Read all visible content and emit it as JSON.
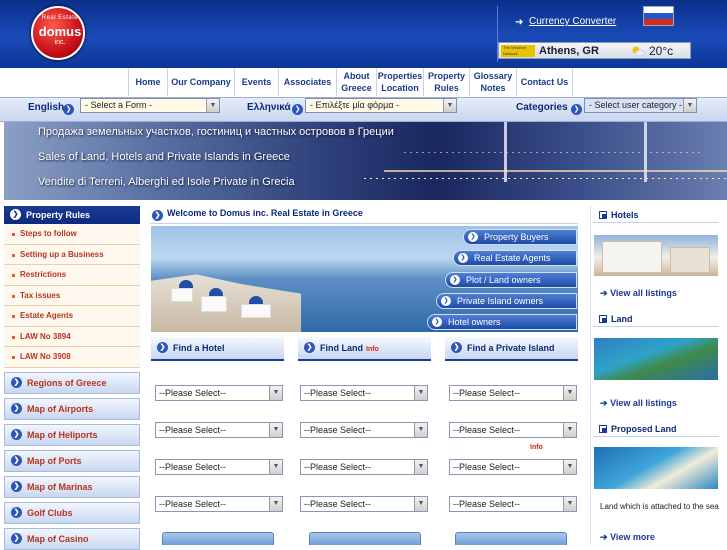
{
  "logo": {
    "top": "Real Estate",
    "name": "domus",
    "sub": "inc."
  },
  "header": {
    "currency_converter": "Currency Converter",
    "weather": {
      "provider": "The Weather Network",
      "city": "Athens, GR",
      "temp": "20°c"
    },
    "flag_colors": [
      "#ffffff",
      "#2456c8",
      "#d52b1e"
    ]
  },
  "topnav": [
    {
      "label": "Home",
      "w": 39
    },
    {
      "label": "Our Company",
      "w": 67
    },
    {
      "label": "Events",
      "w": 44
    },
    {
      "label": "Associates",
      "w": 58
    },
    {
      "label": "About\nGreece",
      "w": 40
    },
    {
      "label": "Properties\nLocation",
      "w": 47
    },
    {
      "label": "Property\nRules",
      "w": 46
    },
    {
      "label": "Glossary\nNotes",
      "w": 47
    },
    {
      "label": "Contact Us",
      "w": 57
    }
  ],
  "langbar": {
    "english_label": "English",
    "english_select": "- Select a Form -",
    "greek_label": "Ελληνικά",
    "greek_select": "- Επιλέξτε μία φόρμα -",
    "categories_label": "Categories",
    "categories_select": "- Select user category -"
  },
  "banner": {
    "line1": "Продажа земельных участков, гостиниц и частных островов в Греции",
    "line2": "Sales of Land, Hotels and Private Islands in Greece",
    "line3": "Vendite di Terreni, Alberghi ed Isole Private in Grecia"
  },
  "sidebar": {
    "header": "Property Rules",
    "items": [
      "Steps to follow",
      "Setting up a Business",
      "Restrictions",
      "Tax issues",
      "Estate Agents",
      "LAW No 3894",
      "LAW No 3908"
    ],
    "buttons": [
      "Regions of Greece",
      "Map of Airports",
      "Map of Heliports",
      "Map of Ports",
      "Map of Marinas",
      "Golf Clubs",
      "Map of Casino"
    ]
  },
  "main": {
    "welcome": "Welcome to Domus inc. Real Estate in Greece",
    "hero_buttons": [
      "Property Buyers",
      "Real Estate Agents",
      "Plot / Land owners",
      "Private Island owners",
      "Hotel owners"
    ],
    "find_tabs": [
      {
        "label": "Find a Hotel",
        "info": ""
      },
      {
        "label": "Find Land",
        "info": "Info"
      },
      {
        "label": "Find a Private Island",
        "info": ""
      }
    ],
    "select_placeholder": "--Please Select--",
    "info_label": "Info"
  },
  "right": {
    "hotels_title": "Hotels",
    "hotels_link": "View all listings",
    "land_title": "Land",
    "land_link": "View all listings",
    "proposed_title": "Proposed Land",
    "proposed_text": "Land which is attached to the sea",
    "proposed_link": "View more"
  }
}
